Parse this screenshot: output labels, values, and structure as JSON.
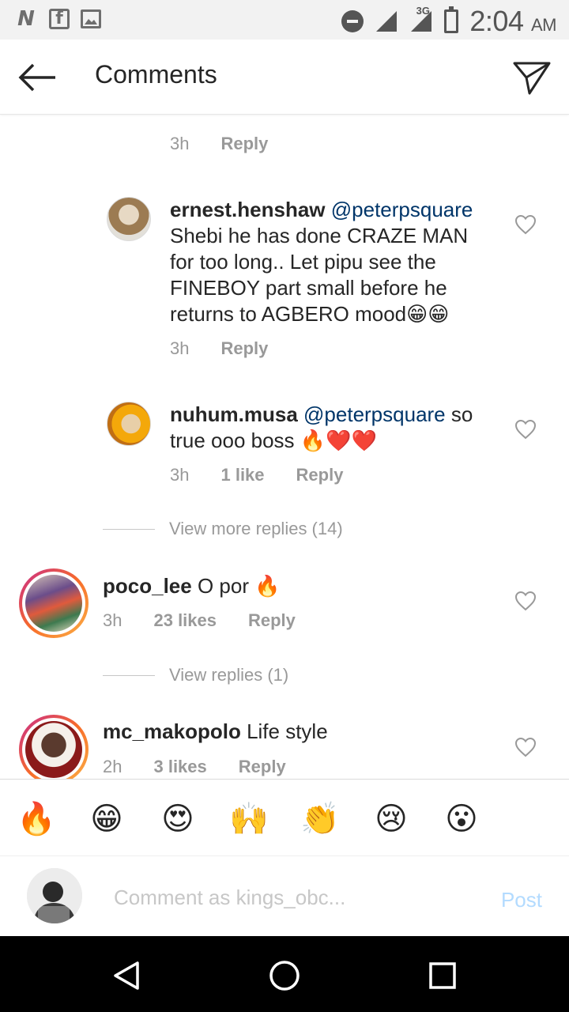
{
  "status_bar": {
    "left_icons": [
      "n-app-icon",
      "flipboard-icon",
      "image-icon"
    ],
    "network": "3G",
    "time": "2:04",
    "ampm": "AM"
  },
  "header": {
    "title": "Comments"
  },
  "top_reply": {
    "time": "3h",
    "reply_label": "Reply"
  },
  "replies": [
    {
      "username": "ernest.henshaw",
      "mention": "@peterpsquare",
      "text_lines": [
        "Shebi he has done CRAZE MAN",
        "for too long.. Let pipu see the",
        "FINEBOY part small before he",
        "returns to AGBERO mood😁😁"
      ],
      "time": "3h",
      "likes": "",
      "reply_label": "Reply"
    },
    {
      "username": "nuhum.musa",
      "mention": "@peterpsquare",
      "text_first": "so",
      "text_second": "true ooo boss 🔥❤️❤️",
      "time": "3h",
      "likes": "1 like",
      "reply_label": "Reply"
    }
  ],
  "view_more_replies": "View more replies (14)",
  "comments": [
    {
      "username": "poco_lee",
      "text": "O por 🔥",
      "time": "3h",
      "likes": "23 likes",
      "reply_label": "Reply",
      "view_replies": "View replies (1)"
    },
    {
      "username": "mc_makopolo",
      "text": "Life style",
      "time": "2h",
      "likes": "3 likes",
      "reply_label": "Reply"
    }
  ],
  "emojis": [
    "🔥",
    "😁",
    "😍",
    "🙌",
    "👏",
    "😢",
    "😮"
  ],
  "composer": {
    "placeholder": "Comment as kings_obc...",
    "post_label": "Post"
  },
  "colors": {
    "mention": "#003569",
    "meta": "#999999",
    "post_disabled": "#b3dbff",
    "story_ring": "#f76b2a"
  }
}
